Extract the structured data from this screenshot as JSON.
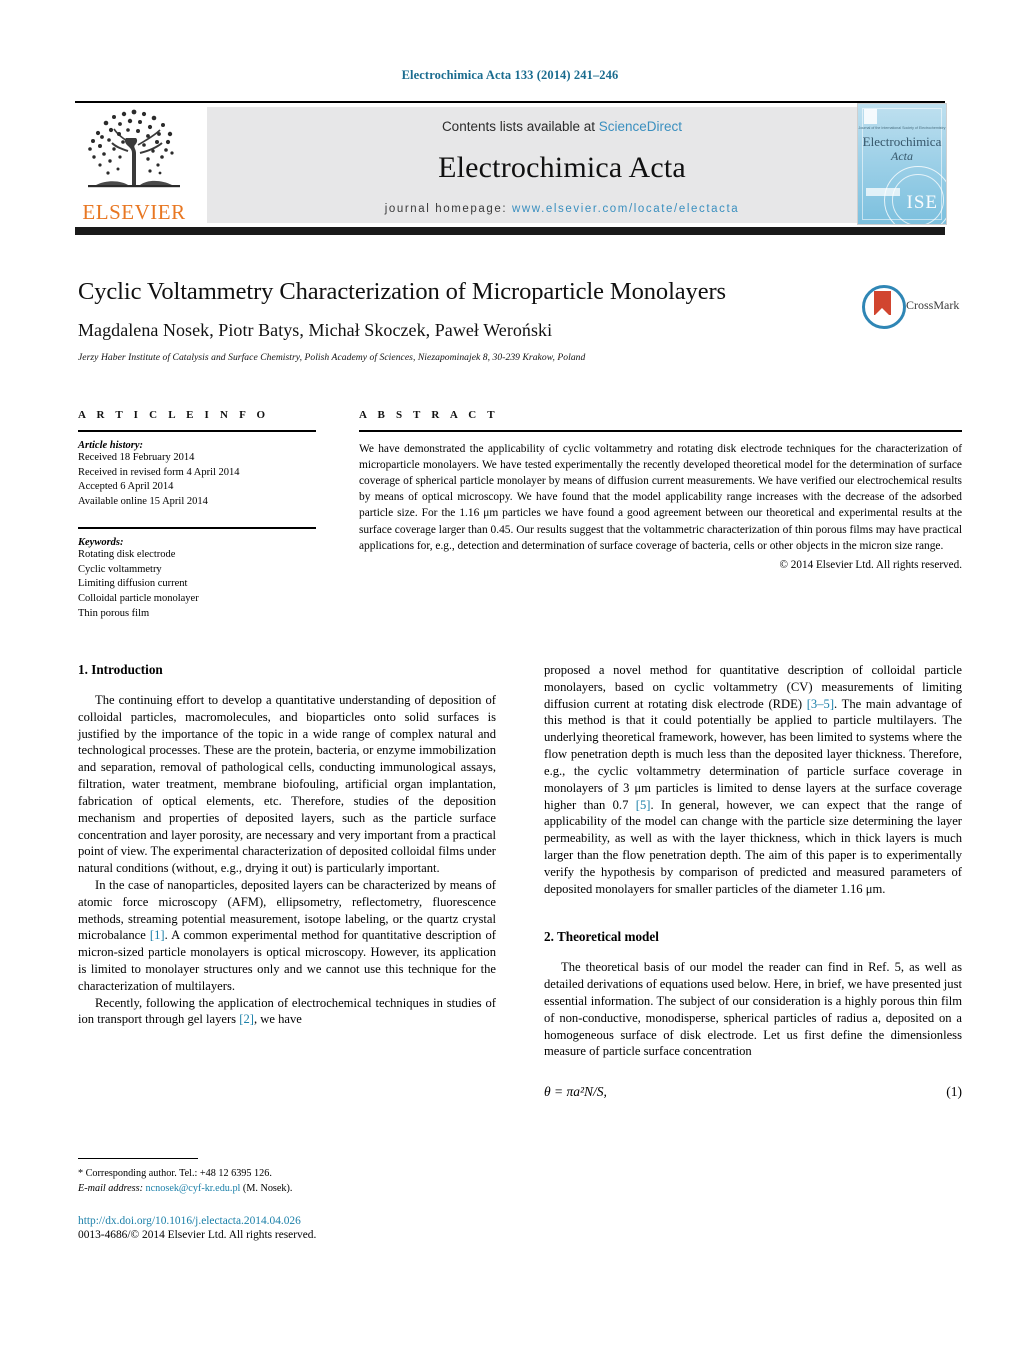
{
  "running_head": "Electrochimica Acta 133 (2014) 241–246",
  "masthead": {
    "contents_prefix": "Contents lists available at ",
    "sciencedirect": "ScienceDirect",
    "journal_name": "Electrochimica Acta",
    "homepage_label": "journal homepage:",
    "homepage_url": "www.elsevier.com/locate/electacta",
    "publisher": "ELSEVIER",
    "link_color": "#3a8fbf",
    "publisher_color": "#E87722",
    "cover": {
      "top_caption": "Journal of the International Society of Electrochemistry",
      "title_line1": "Electrochimica",
      "title_line2": "Acta",
      "seal_text": "ISE"
    }
  },
  "article": {
    "title": "Cyclic Voltammetry Characterization of Microparticle Monolayers",
    "authors": "Magdalena Nosek, Piotr Batys, Michał Skoczek, Paweł Weroński",
    "author_star": "*",
    "affiliation": "Jerzy Haber Institute of Catalysis and Surface Chemistry, Polish Academy of Sciences, Niezapominajek 8, 30-239 Krakow, Poland",
    "crossmark_label": "CrossMark"
  },
  "article_info": {
    "heading": "A R T I C L E   I N F O",
    "history_label": "Article history:",
    "history": [
      "Received 18 February 2014",
      "Received in revised form 4 April 2014",
      "Accepted 6 April 2014",
      "Available online 15 April 2014"
    ],
    "keywords_label": "Keywords:",
    "keywords": [
      "Rotating disk electrode",
      "Cyclic voltammetry",
      "Limiting diffusion current",
      "Colloidal particle monolayer",
      "Thin porous film"
    ]
  },
  "abstract": {
    "heading": "A B S T R A C T",
    "text": "We have demonstrated the applicability of cyclic voltammetry and rotating disk electrode techniques for the characterization of microparticle monolayers. We have tested experimentally the recently developed theoretical model for the determination of surface coverage of spherical particle monolayer by means of diffusion current measurements. We have verified our electrochemical results by means of optical microscopy. We have found that the model applicability range increases with the decrease of the adsorbed particle size. For the 1.16 μm particles we have found a good agreement between our theoretical and experimental results at the surface coverage larger than 0.45. Our results suggest that the voltammetric characterization of thin porous films may have practical applications for, e.g., detection and determination of surface coverage of bacteria, cells or other objects in the micron size range.",
    "copyright": "© 2014 Elsevier Ltd. All rights reserved."
  },
  "body": {
    "section1_heading": "1. Introduction",
    "section1_p1": "The continuing effort to develop a quantitative understanding of deposition of colloidal particles, macromolecules, and biopar­ticles onto solid surfaces is justified by the importance of the topic in a wide range of complex natural and technological pro­cesses. These are the protein, bacteria, or enzyme immobilization and separation, removal of pathological cells, conducting immuno­logical assays, filtration, water treatment, membrane biofouling, artificial organ implantation, fabrication of optical elements, etc. Therefore, studies of the deposition mechanism and properties of deposited layers, such as the particle surface concentration and layer porosity, are necessary and very important from a practical point of view. The experimental characterization of deposited col­loidal films under natural conditions (without, e.g., drying it out) is particularly important.",
    "section1_p2_a": "In the case of nanoparticles, deposited layers can be character­ized by means of atomic force microscopy (AFM), ellipsometry, reflectometry, fluorescence methods, streaming potential mea­surement, isotope labeling, or the quartz crystal microbalance ",
    "section1_p2_ref": "[1]",
    "section1_p2_b": ". A common experimental method for quantitative description of micron-sized particle monolayers is optical microscopy. However, its application is limited to monolayer structures only and we can­not use this technique for the characterization of multilayers.",
    "section1_p3_a": "Recently, following the application of electrochemical tech­niques in studies of ion transport through gel layers ",
    "section1_p3_ref": "[2]",
    "section1_p3_b": ", we have",
    "section1_p4_a": "proposed a novel method for quantitative description of colloidal particle monolayers, based on cyclic voltammetry (CV) measure­ments of limiting diffusion current at rotating disk electrode (RDE) ",
    "section1_p4_ref": "[3–5]",
    "section1_p4_b": ". The main advantage of this method is that it could poten­tially be applied to particle multilayers. The underlying theoretical framework, however, has been limited to systems where the flow penetration depth is much less than the deposited layer thickness. Therefore, e.g., the cyclic voltammetry determination of particle surface coverage in monolayers of 3 μm particles is limited to dense layers at the surface coverage higher than 0.7 ",
    "section1_p4_ref2": "[5]",
    "section1_p4_c": ". In general, how­ever, we can expect that the range of applicability of the model can change with the particle size determining the layer perme­ability, as well as with the layer thickness, which in thick layers is much larger than the flow penetration depth. The aim of this paper is to experimentally verify the hypothesis by comparison of predicted and measured parameters of deposited monolayers for smaller particles of the diameter 1.16 μm.",
    "section2_heading": "2. Theoretical model",
    "section2_p1": "The theoretical basis of our model the reader can find in Ref. 5, as well as detailed derivations of equations used below. Here, in brief, we have presented just essential information. The subject of our consideration is a highly porous thin film of non-conductive, monodisperse, spherical particles of radius a, deposited on a homogeneous surface of disk electrode. Let us first define the dimensionless measure of particle surface concentration",
    "equation1": "θ = πa²N/S,",
    "equation1_number": "(1)"
  },
  "footnote": {
    "corresponding": "* Corresponding author. Tel.: +48 12 6395 126.",
    "email_label": "E-mail address:",
    "email": "ncnosek@cyf-kr.edu.pl",
    "email_suffix": " (M. Nosek).",
    "doi": "http://dx.doi.org/10.1016/j.electacta.2014.04.026",
    "issn": "0013-4686/© 2014 Elsevier Ltd. All rights reserved."
  }
}
